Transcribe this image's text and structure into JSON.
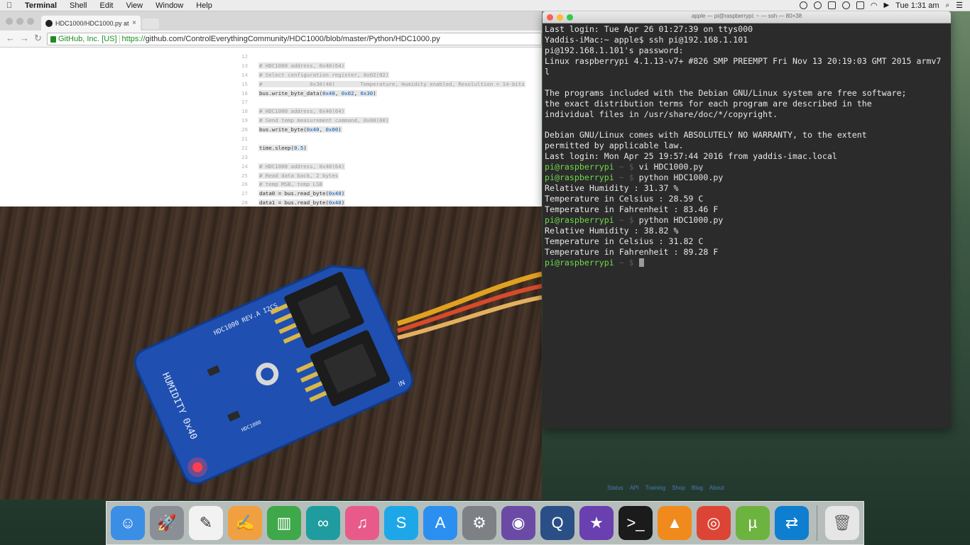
{
  "menubar": {
    "app_name": "Terminal",
    "items": [
      "Shell",
      "Edit",
      "View",
      "Window",
      "Help"
    ],
    "clock": "Tue 1:31 am"
  },
  "browser": {
    "tab_title": "HDC1000/HDC1000.py at",
    "tab_close": "×",
    "ev_label": "GitHub, Inc. [US]",
    "url_scheme": "https://",
    "url_rest": "github.com/ControlEverythingCommunity/HDC1000/blob/master/Python/HDC1000.py",
    "code_lines": [
      {
        "n": "12",
        "t": "",
        "kind": "cd"
      },
      {
        "n": "13",
        "t": "# HDC1000 address, 0x40(64)",
        "kind": "cm"
      },
      {
        "n": "14",
        "t": "# Select configuration register, 0x02(02)",
        "kind": "cm"
      },
      {
        "n": "15",
        "t": "#\t\t0x30(48)\tTemperature, Humidity enabled, Resolultion = 14-bits",
        "kind": "cm"
      },
      {
        "n": "16",
        "t": "bus.write_byte_data(0x40, 0x02, 0x30)",
        "kind": "cd"
      },
      {
        "n": "17",
        "t": "",
        "kind": "cd"
      },
      {
        "n": "18",
        "t": "# HDC1000 address, 0x40(64)",
        "kind": "cm"
      },
      {
        "n": "19",
        "t": "# Send temp measurement command, 0x00(00)",
        "kind": "cm"
      },
      {
        "n": "20",
        "t": "bus.write_byte(0x40, 0x00)",
        "kind": "cd"
      },
      {
        "n": "21",
        "t": "",
        "kind": "cd"
      },
      {
        "n": "22",
        "t": "time.sleep(0.5)",
        "kind": "cd"
      },
      {
        "n": "23",
        "t": "",
        "kind": "cd"
      },
      {
        "n": "24",
        "t": "# HDC1000 address, 0x40(64)",
        "kind": "cm"
      },
      {
        "n": "25",
        "t": "# Read data back, 2 bytes",
        "kind": "cm"
      },
      {
        "n": "26",
        "t": "# temp MSB, temp LSB",
        "kind": "cm"
      },
      {
        "n": "27",
        "t": "data0 = bus.read_byte(0x40)",
        "kind": "cd"
      },
      {
        "n": "28",
        "t": "data1 = bus.read_byte(0x40)",
        "kind": "cd"
      }
    ],
    "footer_links": [
      "Status",
      "API",
      "Training",
      "Shop",
      "Blog",
      "About"
    ]
  },
  "photo": {
    "board_label": "HUMIDITY 0x40",
    "chip_label": "HDC1000",
    "small_label": "HDC1000 REV.A I2CS",
    "connector_label": "IN"
  },
  "terminal": {
    "title": "apple — pi@raspberrypi: ~ — ssh — 80×38",
    "lines": [
      {
        "segments": [
          {
            "t": "Last login: Tue Apr 26 01:27:39 on ttys000",
            "c": ""
          }
        ]
      },
      {
        "segments": [
          {
            "t": "Yaddis-iMac:~ apple$ ssh pi@192.168.1.101",
            "c": ""
          }
        ]
      },
      {
        "segments": [
          {
            "t": "pi@192.168.1.101's password:",
            "c": ""
          }
        ]
      },
      {
        "segments": [
          {
            "t": "Linux raspberrypi 4.1.13-v7+ #826 SMP PREEMPT Fri Nov 13 20:19:03 GMT 2015 armv7",
            "c": ""
          }
        ]
      },
      {
        "segments": [
          {
            "t": "l",
            "c": ""
          }
        ]
      },
      {
        "segments": [
          {
            "t": "",
            "c": ""
          }
        ]
      },
      {
        "segments": [
          {
            "t": "The programs included with the Debian GNU/Linux system are free software;",
            "c": ""
          }
        ]
      },
      {
        "segments": [
          {
            "t": "the exact distribution terms for each program are described in the",
            "c": ""
          }
        ]
      },
      {
        "segments": [
          {
            "t": "individual files in /usr/share/doc/*/copyright.",
            "c": ""
          }
        ]
      },
      {
        "segments": [
          {
            "t": "",
            "c": ""
          }
        ]
      },
      {
        "segments": [
          {
            "t": "Debian GNU/Linux comes with ABSOLUTELY NO WARRANTY, to the extent",
            "c": ""
          }
        ]
      },
      {
        "segments": [
          {
            "t": "permitted by applicable law.",
            "c": ""
          }
        ]
      },
      {
        "segments": [
          {
            "t": "Last login: Mon Apr 25 19:57:44 2016 from yaddis-imac.local",
            "c": ""
          }
        ]
      },
      {
        "segments": [
          {
            "t": "pi@raspberrypi",
            "c": "prompt"
          },
          {
            "t": " ~ $",
            "c": "dim"
          },
          {
            "t": " vi HDC1000.py",
            "c": ""
          }
        ]
      },
      {
        "segments": [
          {
            "t": "pi@raspberrypi",
            "c": "prompt"
          },
          {
            "t": " ~ $",
            "c": "dim"
          },
          {
            "t": " python HDC1000.py",
            "c": ""
          }
        ]
      },
      {
        "segments": [
          {
            "t": "Relative Humidity : 31.37 %",
            "c": ""
          }
        ]
      },
      {
        "segments": [
          {
            "t": "Temperature in Celsius : 28.59 C",
            "c": ""
          }
        ]
      },
      {
        "segments": [
          {
            "t": "Temperature in Fahrenheit : 83.46 F",
            "c": ""
          }
        ]
      },
      {
        "segments": [
          {
            "t": "pi@raspberrypi",
            "c": "prompt"
          },
          {
            "t": " ~ $",
            "c": "dim"
          },
          {
            "t": " python HDC1000.py",
            "c": ""
          }
        ]
      },
      {
        "segments": [
          {
            "t": "Relative Humidity : 38.82 %",
            "c": ""
          }
        ]
      },
      {
        "segments": [
          {
            "t": "Temperature in Celsius : 31.82 C",
            "c": ""
          }
        ]
      },
      {
        "segments": [
          {
            "t": "Temperature in Fahrenheit : 89.28 F",
            "c": ""
          }
        ]
      },
      {
        "segments": [
          {
            "t": "pi@raspberrypi",
            "c": "prompt"
          },
          {
            "t": " ~ $",
            "c": "dim"
          },
          {
            "t": " ",
            "c": ""
          }
        ],
        "cursor": true
      }
    ]
  },
  "dock": {
    "apps": [
      {
        "name": "finder-icon",
        "glyph": "☺",
        "bg": "#3a8ee6"
      },
      {
        "name": "launchpad-icon",
        "glyph": "🚀",
        "bg": "#8a8f95"
      },
      {
        "name": "textedit-icon",
        "glyph": "✎",
        "bg": "#f2f2f2"
      },
      {
        "name": "pages-icon",
        "glyph": "✍",
        "bg": "#f0a040"
      },
      {
        "name": "numbers-icon",
        "glyph": "▥",
        "bg": "#3fa84a"
      },
      {
        "name": "arduino-icon",
        "glyph": "∞",
        "bg": "#1f9ca0"
      },
      {
        "name": "itunes-icon",
        "glyph": "♫",
        "bg": "#e85a8a"
      },
      {
        "name": "skype-icon",
        "glyph": "S",
        "bg": "#1ea7e8"
      },
      {
        "name": "app-store-icon",
        "glyph": "A",
        "bg": "#2b8ff0"
      },
      {
        "name": "system-preferences-icon",
        "glyph": "⚙",
        "bg": "#7d8085"
      },
      {
        "name": "github-desktop-icon",
        "glyph": "◉",
        "bg": "#6b4aa6"
      },
      {
        "name": "quicktime-icon",
        "glyph": "Q",
        "bg": "#2a4f86"
      },
      {
        "name": "imovie-icon",
        "glyph": "★",
        "bg": "#6a3fb0"
      },
      {
        "name": "terminal-icon",
        "glyph": ">_",
        "bg": "#1b1b1b"
      },
      {
        "name": "vlc-icon",
        "glyph": "▲",
        "bg": "#f08a1c"
      },
      {
        "name": "chrome-icon",
        "glyph": "◎",
        "bg": "#dc4535"
      },
      {
        "name": "utorrent-icon",
        "glyph": "µ",
        "bg": "#6db33f"
      },
      {
        "name": "teamviewer-icon",
        "glyph": "⇄",
        "bg": "#0e7fd0"
      }
    ],
    "trash": {
      "name": "trash-icon",
      "glyph": "🗑",
      "bg": "#e6e6e6"
    }
  }
}
